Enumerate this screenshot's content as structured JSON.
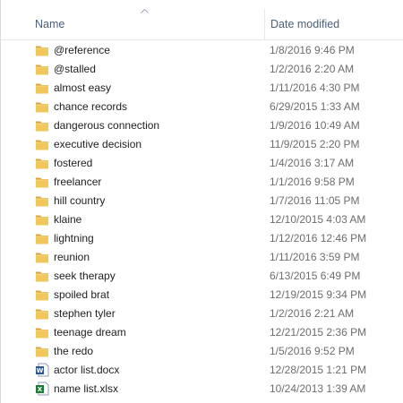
{
  "header": {
    "name_label": "Name",
    "date_label": "Date modified",
    "sort": "ascending"
  },
  "files": [
    {
      "name": "@reference",
      "date": "1/8/2016 9:46 PM",
      "type": "folder"
    },
    {
      "name": "@stalled",
      "date": "1/2/2016 2:20 AM",
      "type": "folder"
    },
    {
      "name": "almost easy",
      "date": "1/11/2016 4:30 PM",
      "type": "folder"
    },
    {
      "name": "chance records",
      "date": "6/29/2015 1:33 AM",
      "type": "folder"
    },
    {
      "name": "dangerous connection",
      "date": "1/9/2016 10:49 AM",
      "type": "folder"
    },
    {
      "name": "executive decision",
      "date": "11/9/2015 2:20 PM",
      "type": "folder"
    },
    {
      "name": "fostered",
      "date": "1/4/2016 3:17 AM",
      "type": "folder"
    },
    {
      "name": "freelancer",
      "date": "1/1/2016 9:58 PM",
      "type": "folder"
    },
    {
      "name": "hill country",
      "date": "1/7/2016 11:05 PM",
      "type": "folder"
    },
    {
      "name": "klaine",
      "date": "12/10/2015 4:03 AM",
      "type": "folder"
    },
    {
      "name": "lightning",
      "date": "1/12/2016 12:46 PM",
      "type": "folder"
    },
    {
      "name": "reunion",
      "date": "1/11/2016 3:59 PM",
      "type": "folder"
    },
    {
      "name": "seek therapy",
      "date": "6/13/2015 6:49 PM",
      "type": "folder"
    },
    {
      "name": "spoiled brat",
      "date": "12/19/2015 9:34 PM",
      "type": "folder"
    },
    {
      "name": "stephen tyler",
      "date": "1/2/2016 2:21 AM",
      "type": "folder"
    },
    {
      "name": "teenage dream",
      "date": "12/21/2015 2:36 PM",
      "type": "folder"
    },
    {
      "name": "the redo",
      "date": "1/5/2016 9:52 PM",
      "type": "folder"
    },
    {
      "name": "actor list.docx",
      "date": "12/28/2015 1:21 PM",
      "type": "word"
    },
    {
      "name": "name list.xlsx",
      "date": "10/24/2013 1:39 AM",
      "type": "excel"
    }
  ],
  "colors": {
    "folder": "#e8b64a",
    "word": "#2b5797",
    "excel": "#1f7a3a",
    "header_text": "#4c607a",
    "date_text": "#6d6d6d"
  }
}
